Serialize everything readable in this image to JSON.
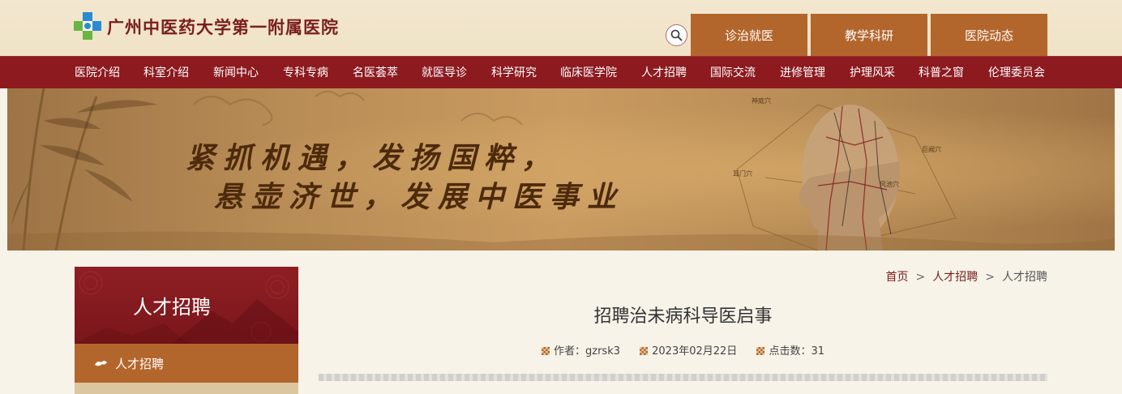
{
  "site": {
    "name": "广州中医药大学第一附属医院"
  },
  "top_tabs": [
    "诊治就医",
    "教学科研",
    "医院动态"
  ],
  "nav": {
    "items": [
      "医院介绍",
      "科室介绍",
      "新闻中心",
      "专科专病",
      "名医荟萃",
      "就医导诊",
      "科学研究",
      "临床医学院",
      "人才招聘",
      "国际交流",
      "进修管理",
      "护理风采",
      "科普之窗",
      "伦理委员会"
    ]
  },
  "banner": {
    "line1": "紧抓机遇，发扬国粹，",
    "line2": "悬壶济世，发展中医事业",
    "acupoints": [
      "神庭穴",
      "耳门穴",
      "巨阙穴",
      "风池穴"
    ]
  },
  "sidebar": {
    "title": "人才招聘",
    "items": [
      {
        "label": "人才招聘"
      }
    ]
  },
  "breadcrumb": {
    "items": [
      "首页",
      "人才招聘",
      "人才招聘"
    ],
    "separator": ">"
  },
  "article": {
    "title": "招聘治未病科导医启事",
    "author_label": "作者：",
    "author": "gzrsk3",
    "date": "2023年02月22日",
    "views_label": "点击数：",
    "views": "31"
  },
  "colors": {
    "brand_red": "#8c1a1f",
    "accent_orange": "#b3662c",
    "header_bg": "#f3e7cf",
    "page_bg": "#f7f3e9"
  }
}
